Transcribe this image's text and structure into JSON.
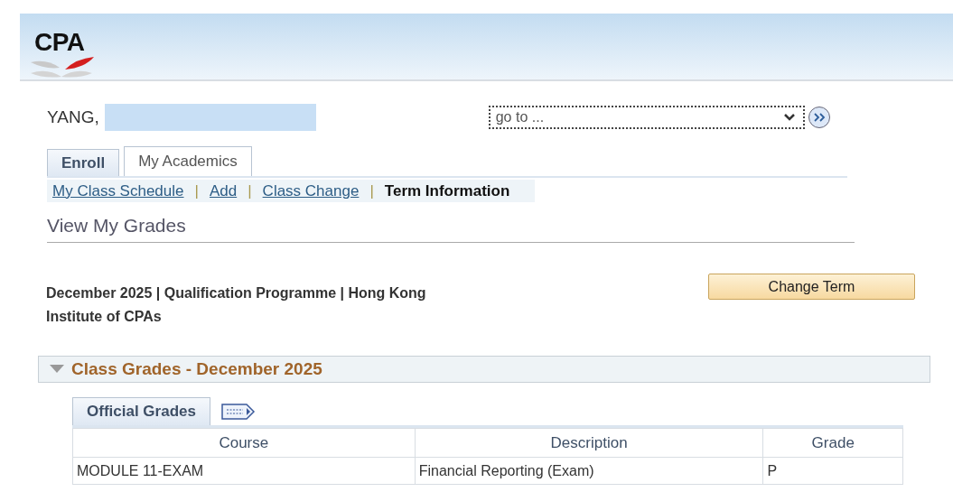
{
  "header": {
    "logo_text": "CPA"
  },
  "student": {
    "name": "YANG,"
  },
  "goto": {
    "placeholder": "go to ..."
  },
  "tabs": [
    {
      "label": "Enroll",
      "selected": true
    },
    {
      "label": "My Academics",
      "selected": false
    }
  ],
  "sub_links": [
    {
      "label": "My Class Schedule",
      "selected": false
    },
    {
      "label": "Add",
      "selected": false
    },
    {
      "label": "Class Change",
      "selected": false
    },
    {
      "label": "Term Information",
      "selected": true
    }
  ],
  "sub_link_separator": "|",
  "page_title": "View My Grades",
  "term": {
    "text": "December 2025 | Qualification Programme | Hong Kong Institute of CPAs",
    "button": "Change Term"
  },
  "section": {
    "title": "Class Grades - December 2025",
    "expanded": true
  },
  "grid": {
    "tab": "Official Grades",
    "columns": [
      "Course",
      "Description",
      "Grade"
    ],
    "rows": [
      [
        "MODULE 11-EXAM",
        "Financial Reporting (Exam)",
        "P"
      ]
    ]
  }
}
